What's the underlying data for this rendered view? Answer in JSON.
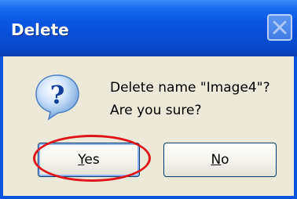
{
  "window": {
    "title": "Delete"
  },
  "icons": {
    "dialog": "question-icon",
    "close": "close-icon"
  },
  "message": {
    "line1": "Delete name \"Image4\"?",
    "line2": "Are you sure?"
  },
  "buttons": {
    "yes": {
      "mnemonic": "Y",
      "rest": "es"
    },
    "no": {
      "mnemonic": "N",
      "rest": "o"
    }
  },
  "colors": {
    "titlebar": "#0a55e0",
    "dialog_bg": "#ece9d8",
    "highlight": "#e0151b"
  }
}
